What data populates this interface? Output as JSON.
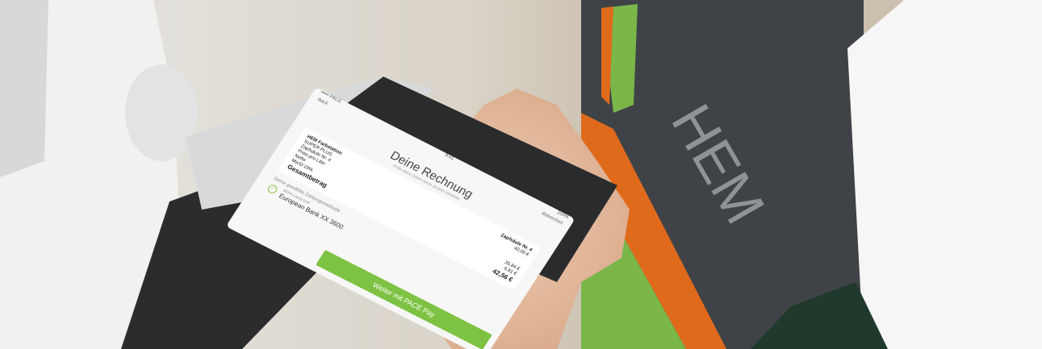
{
  "phone": {
    "status_left": "••••• PACE",
    "status_center": "9:41",
    "status_right": "100%",
    "nav_back": "Back",
    "nav_right": "Abbrechen",
    "title": "Deine Rechnung",
    "subtitle": "Prüfe deine Daten bevor du jetzt bezahlst.",
    "pump_label": "Zapfsäule Nr. 4",
    "station": "HEM Farbstation",
    "item_fuel": "SUPER PLUS",
    "item_fuel_amount": "40,00 €",
    "item_detail": "Zapfsäule Nr. 4",
    "item_detail2": "Preis pro Liter",
    "item_net_label": "Netto",
    "item_net": "35,84 €",
    "item_vat_label": "MwSt 19%",
    "item_vat": "6,81 €",
    "total_label": "Gesamtbetrag",
    "total": "42,56 €",
    "pay_prompt": "Deine gewählte Zahlungsmethode",
    "pay_method_small": "SEPA Lastschrift",
    "pay_method": "European Bank XX 3600",
    "cta": "Weiter mit PACE Pay"
  },
  "colors": {
    "accent": "#7dc242",
    "hem_orange": "#e06a1c",
    "hem_dark": "#3f4347"
  }
}
